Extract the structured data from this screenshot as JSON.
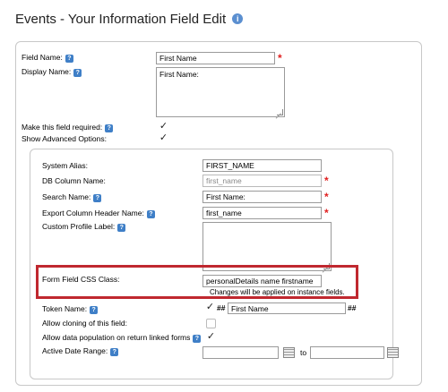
{
  "page": {
    "title": "Events - Your Information Field Edit",
    "help_glyph": "?"
  },
  "fields": {
    "field_name": {
      "label": "Field Name:",
      "value": "First Name",
      "required_mark": "*"
    },
    "display_name": {
      "label": "Display Name:",
      "value": "First Name:"
    },
    "make_required": {
      "label": "Make this field required:",
      "checked": true
    },
    "show_advanced": {
      "label": "Show Advanced Options:",
      "checked": true
    }
  },
  "advanced": {
    "system_alias": {
      "label": "System Alias:",
      "value": "FIRST_NAME"
    },
    "db_column_name": {
      "label": "DB Column Name:",
      "value": "first_name",
      "required_mark": "*"
    },
    "search_name": {
      "label": "Search Name:",
      "value": "First Name:",
      "required_mark": "*"
    },
    "export_header": {
      "label": "Export Column Header Name:",
      "value": "first_name",
      "required_mark": "*"
    },
    "custom_profile_label": {
      "label": "Custom Profile Label:",
      "value": ""
    },
    "css_class": {
      "label": "Form Field CSS Class:",
      "value": "personalDetails name firstname",
      "note": "Changes will be applied on instance fields."
    },
    "token_name": {
      "label": "Token Name:",
      "checked": true,
      "prefix": "##",
      "value": "First Name",
      "suffix": "##"
    },
    "allow_cloning": {
      "label": "Allow cloning of this field:",
      "checked": false
    },
    "allow_population": {
      "label": "Allow data population on return linked forms",
      "checked": true
    },
    "active_date_range": {
      "label": "Active Date Range:",
      "from": "",
      "to_label": "to",
      "to": ""
    }
  },
  "check_glyph": "✓",
  "colors": {
    "required": "#e02020",
    "highlight": "#c0282f",
    "help": "#3f7fc7"
  }
}
